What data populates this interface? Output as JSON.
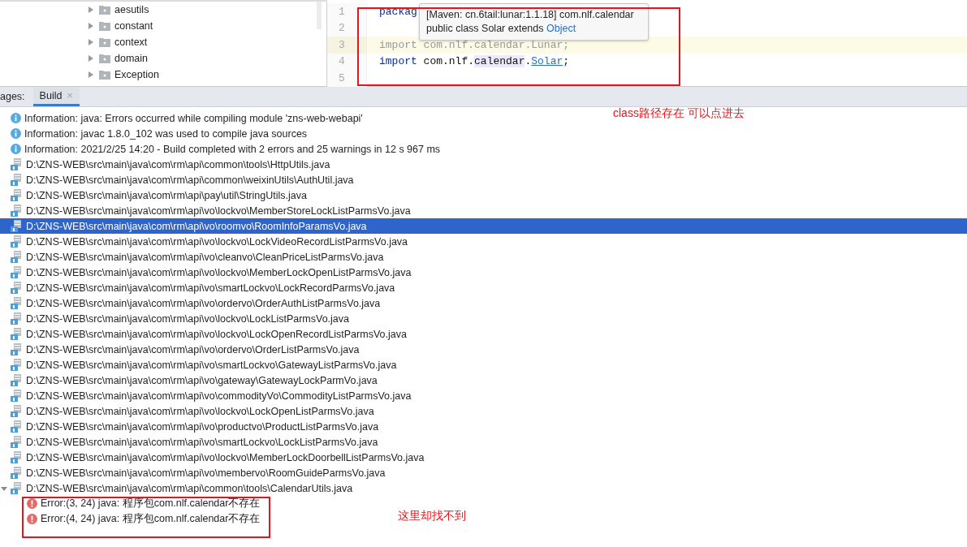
{
  "project_tree": {
    "items": [
      {
        "label": "aesutils",
        "expanded": false
      },
      {
        "label": "constant",
        "expanded": false
      },
      {
        "label": "context",
        "expanded": false
      },
      {
        "label": "domain",
        "expanded": false
      },
      {
        "label": "Exception",
        "expanded": false
      }
    ]
  },
  "editor": {
    "lines": [
      {
        "number": "1",
        "current": false,
        "segments": [
          {
            "kind": "keyword",
            "text": "packag"
          }
        ]
      },
      {
        "number": "2",
        "current": false
      },
      {
        "number": "3",
        "current": true,
        "segments": [
          {
            "kind": "unused",
            "text": "import com.nlf.calendar.Lunar;"
          }
        ]
      },
      {
        "number": "4",
        "current": false,
        "segments": [
          {
            "kind": "keyword",
            "text": "import"
          },
          {
            "kind": "plain",
            "text": " com.nlf."
          },
          {
            "kind": "highlight",
            "text": "calendar"
          },
          {
            "kind": "plain",
            "text": "."
          },
          {
            "kind": "link",
            "text": "Solar"
          },
          {
            "kind": "plain",
            "text": ";"
          }
        ]
      },
      {
        "number": "5",
        "current": false
      }
    ],
    "tooltip": {
      "line_1": "[Maven: cn.6tail:lunar:1.1.18] com.nlf.calendar",
      "line_2": "public class Solar extends ",
      "link": "Object"
    }
  },
  "build_panel": {
    "tool_window_label": "ages:",
    "tabs": [
      {
        "label": "Build",
        "close": "×",
        "selected": true
      }
    ],
    "messages": [
      {
        "kind": "info",
        "selected": false,
        "text": "Information: java: Errors occurred while compiling module 'zns-web-webapi'"
      },
      {
        "kind": "info",
        "selected": false,
        "text": "Information: javac 1.8.0_102 was used to compile java sources"
      },
      {
        "kind": "info",
        "selected": false,
        "text": "Information: 2021/2/25 14:20 - Build completed with 2 errors and 25 warnings in 12 s 967 ms"
      },
      {
        "kind": "file",
        "selected": false,
        "text": "D:\\ZNS-WEB\\src\\main\\java\\com\\rm\\api\\common\\tools\\HttpUtils.java"
      },
      {
        "kind": "file",
        "selected": false,
        "text": "D:\\ZNS-WEB\\src\\main\\java\\com\\rm\\api\\common\\weixinUtils\\AuthUtil.java"
      },
      {
        "kind": "file",
        "selected": false,
        "text": "D:\\ZNS-WEB\\src\\main\\java\\com\\rm\\api\\pay\\util\\StringUtils.java"
      },
      {
        "kind": "file",
        "selected": false,
        "text": "D:\\ZNS-WEB\\src\\main\\java\\com\\rm\\api\\vo\\lockvo\\MemberStoreLockListParmsVo.java"
      },
      {
        "kind": "file",
        "selected": true,
        "text": "D:\\ZNS-WEB\\src\\main\\java\\com\\rm\\api\\vo\\roomvo\\RoomInfoParamsVo.java"
      },
      {
        "kind": "file",
        "selected": false,
        "text": "D:\\ZNS-WEB\\src\\main\\java\\com\\rm\\api\\vo\\lockvo\\LockVideoRecordListParmsVo.java"
      },
      {
        "kind": "file",
        "selected": false,
        "text": "D:\\ZNS-WEB\\src\\main\\java\\com\\rm\\api\\vo\\cleanvo\\CleanPriceListParmsVo.java"
      },
      {
        "kind": "file",
        "selected": false,
        "text": "D:\\ZNS-WEB\\src\\main\\java\\com\\rm\\api\\vo\\lockvo\\MemberLockOpenListParmsVo.java"
      },
      {
        "kind": "file",
        "selected": false,
        "text": "D:\\ZNS-WEB\\src\\main\\java\\com\\rm\\api\\vo\\smartLockvo\\LockRecordParmsVo.java"
      },
      {
        "kind": "file",
        "selected": false,
        "text": "D:\\ZNS-WEB\\src\\main\\java\\com\\rm\\api\\vo\\ordervo\\OrderAuthListParmsVo.java"
      },
      {
        "kind": "file",
        "selected": false,
        "text": "D:\\ZNS-WEB\\src\\main\\java\\com\\rm\\api\\vo\\lockvo\\LockListParmsVo.java"
      },
      {
        "kind": "file",
        "selected": false,
        "text": "D:\\ZNS-WEB\\src\\main\\java\\com\\rm\\api\\vo\\lockvo\\LockOpenRecordListParmsVo.java"
      },
      {
        "kind": "file",
        "selected": false,
        "text": "D:\\ZNS-WEB\\src\\main\\java\\com\\rm\\api\\vo\\ordervo\\OrderListParmsVo.java"
      },
      {
        "kind": "file",
        "selected": false,
        "text": "D:\\ZNS-WEB\\src\\main\\java\\com\\rm\\api\\vo\\smartLockvo\\GatewayListParmsVo.java"
      },
      {
        "kind": "file",
        "selected": false,
        "text": "D:\\ZNS-WEB\\src\\main\\java\\com\\rm\\api\\vo\\gateway\\GatewayLockParmVo.java"
      },
      {
        "kind": "file",
        "selected": false,
        "text": "D:\\ZNS-WEB\\src\\main\\java\\com\\rm\\api\\vo\\commodityVo\\CommodityListParmsVo.java"
      },
      {
        "kind": "file",
        "selected": false,
        "text": "D:\\ZNS-WEB\\src\\main\\java\\com\\rm\\api\\vo\\lockvo\\LockOpenListParmsVo.java"
      },
      {
        "kind": "file",
        "selected": false,
        "text": "D:\\ZNS-WEB\\src\\main\\java\\com\\rm\\api\\vo\\productvo\\ProductListParmsVo.java"
      },
      {
        "kind": "file",
        "selected": false,
        "text": "D:\\ZNS-WEB\\src\\main\\java\\com\\rm\\api\\vo\\smartLockvo\\LockListParmsVo.java"
      },
      {
        "kind": "file",
        "selected": false,
        "text": "D:\\ZNS-WEB\\src\\main\\java\\com\\rm\\api\\vo\\lockvo\\MemberLockDoorbellListParmsVo.java"
      },
      {
        "kind": "file",
        "selected": false,
        "text": "D:\\ZNS-WEB\\src\\main\\java\\com\\rm\\api\\vo\\membervo\\RoomGuideParmsVo.java"
      },
      {
        "kind": "file",
        "selected": false,
        "expanded": true,
        "text": "D:\\ZNS-WEB\\src\\main\\java\\com\\rm\\api\\common\\tools\\CalendarUtils.java",
        "children": [
          {
            "kind": "error",
            "selected": false,
            "text": "Error:(3, 24)  java: 程序包com.nlf.calendar不存在"
          },
          {
            "kind": "error",
            "selected": false,
            "text": "Error:(4, 24)  java: 程序包com.nlf.calendar不存在"
          }
        ]
      }
    ]
  },
  "annotations": [
    {
      "text": "class路径存在 可以点进去"
    },
    {
      "text": "这里却找不到"
    }
  ]
}
